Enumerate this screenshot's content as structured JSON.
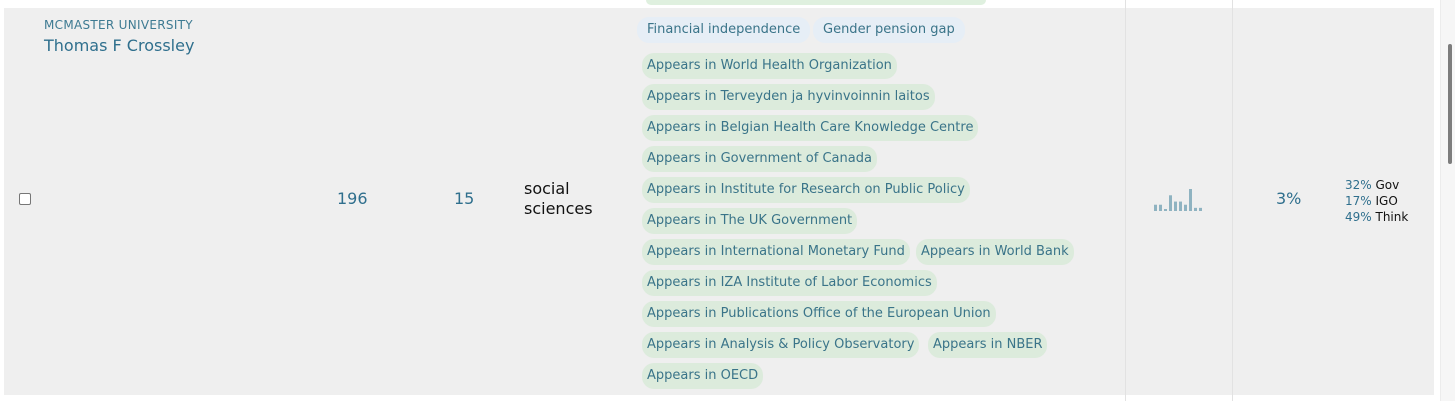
{
  "researcher": {
    "institution": "MCMASTER UNIVERSITY",
    "name": "Thomas F Crossley",
    "metric_a": "196",
    "metric_b": "15",
    "field_line1": "social",
    "field_line2": "sciences",
    "percent": "3%"
  },
  "topics": [
    "Financial independence",
    "Gender pension gap"
  ],
  "appearances": [
    "Appears in World Health Organization",
    "Appears in Terveyden ja hyvinvoinnin laitos",
    "Appears in Belgian Health Care Knowledge Centre",
    "Appears in Government of Canada",
    "Appears in Institute for Research on Public Policy",
    "Appears in The UK Government",
    "Appears in International Monetary Fund",
    "Appears in World Bank",
    "Appears in IZA Institute of Labor Economics",
    "Appears in Publications Office of the European Union",
    "Appears in Analysis & Policy Observatory",
    "Appears in NBER",
    "Appears in OECD"
  ],
  "breakdown": [
    {
      "pct": "32%",
      "label": "Gov"
    },
    {
      "pct": "17%",
      "label": "IGO"
    },
    {
      "pct": "49%",
      "label": "Think"
    }
  ],
  "sparkline": {
    "values": [
      2,
      2,
      0,
      5,
      3,
      3,
      2,
      7,
      1,
      1
    ],
    "color": "#8fb3c1"
  },
  "colors": {
    "link": "#2f6f8d",
    "topic_tag_bg": "#e6eef6",
    "source_tag_bg": "#dcebdc",
    "row_bg": "#efefef"
  }
}
